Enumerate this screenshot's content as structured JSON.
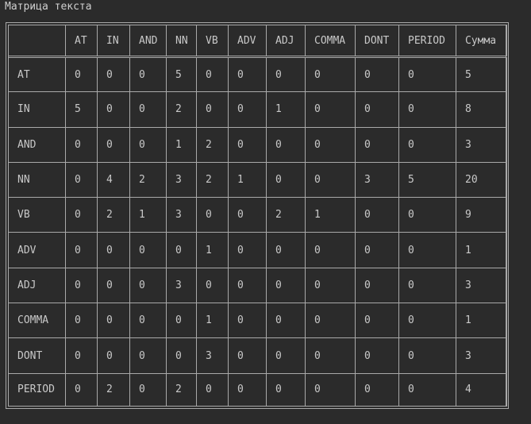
{
  "title": "Матрица текста",
  "table": {
    "columns": [
      "",
      "AT",
      "IN",
      "AND",
      "NN",
      "VB",
      "ADV",
      "ADJ",
      "COMMA",
      "DONT",
      "PERIOD",
      "Сумма"
    ],
    "rows": [
      {
        "label": "AT",
        "values": [
          "0",
          "0",
          "0",
          "5",
          "0",
          "0",
          "0",
          "0",
          "0",
          "0",
          "5"
        ]
      },
      {
        "label": "IN",
        "values": [
          "5",
          "0",
          "0",
          "2",
          "0",
          "0",
          "1",
          "0",
          "0",
          "0",
          "8"
        ]
      },
      {
        "label": "AND",
        "values": [
          "0",
          "0",
          "0",
          "1",
          "2",
          "0",
          "0",
          "0",
          "0",
          "0",
          "3"
        ]
      },
      {
        "label": "NN",
        "values": [
          "0",
          "4",
          "2",
          "3",
          "2",
          "1",
          "0",
          "0",
          "3",
          "5",
          "20"
        ]
      },
      {
        "label": "VB",
        "values": [
          "0",
          "2",
          "1",
          "3",
          "0",
          "0",
          "2",
          "1",
          "0",
          "0",
          "9"
        ]
      },
      {
        "label": "ADV",
        "values": [
          "0",
          "0",
          "0",
          "0",
          "1",
          "0",
          "0",
          "0",
          "0",
          "0",
          "1"
        ]
      },
      {
        "label": "ADJ",
        "values": [
          "0",
          "0",
          "0",
          "3",
          "0",
          "0",
          "0",
          "0",
          "0",
          "0",
          "3"
        ]
      },
      {
        "label": "COMMA",
        "values": [
          "0",
          "0",
          "0",
          "0",
          "1",
          "0",
          "0",
          "0",
          "0",
          "0",
          "1"
        ]
      },
      {
        "label": "DONT",
        "values": [
          "0",
          "0",
          "0",
          "0",
          "3",
          "0",
          "0",
          "0",
          "0",
          "0",
          "3"
        ]
      },
      {
        "label": "PERIOD",
        "values": [
          "0",
          "2",
          "0",
          "2",
          "0",
          "0",
          "0",
          "0",
          "0",
          "0",
          "4"
        ]
      }
    ]
  }
}
